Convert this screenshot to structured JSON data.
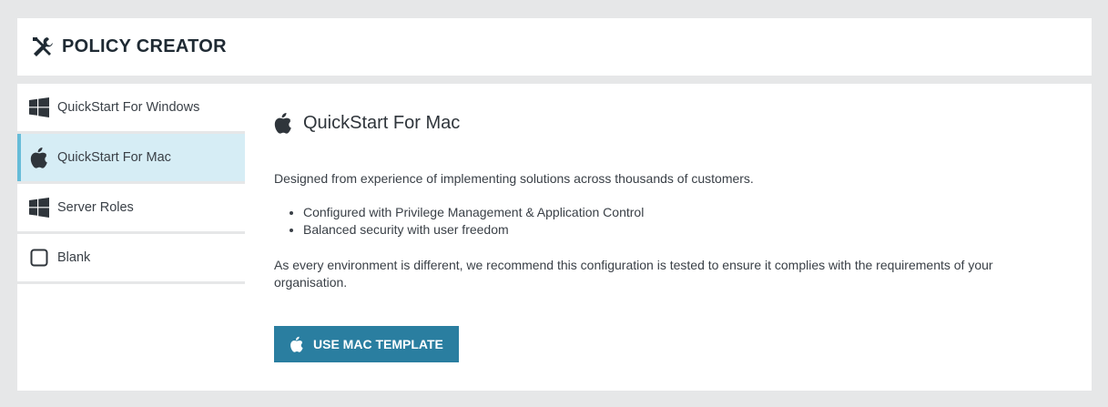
{
  "header": {
    "icon": "tools-icon",
    "title": "POLICY CREATOR"
  },
  "sidebar": {
    "items": [
      {
        "label": "QuickStart For Windows",
        "icon": "windows-icon",
        "active": false
      },
      {
        "label": "QuickStart For Mac",
        "icon": "apple-icon",
        "active": true
      },
      {
        "label": "Server Roles",
        "icon": "windows-icon",
        "active": false
      },
      {
        "label": "Blank",
        "icon": "square-icon",
        "active": false
      }
    ]
  },
  "main": {
    "title": "QuickStart For Mac",
    "title_icon": "apple-icon",
    "description": "Designed from experience of implementing solutions across thousands of customers.",
    "bullets": [
      "Configured with Privilege Management & Application Control",
      "Balanced security with user freedom"
    ],
    "note": "As every environment is different, we recommend this configuration is tested to ensure it complies with the requirements of your organisation.",
    "button_label": "USE MAC TEMPLATE",
    "button_icon": "apple-icon"
  },
  "colors": {
    "background": "#e6e7e8",
    "active_item_bg": "#d6edf5",
    "active_item_accent": "#67bcd8",
    "button_bg": "#2a7ea0"
  }
}
